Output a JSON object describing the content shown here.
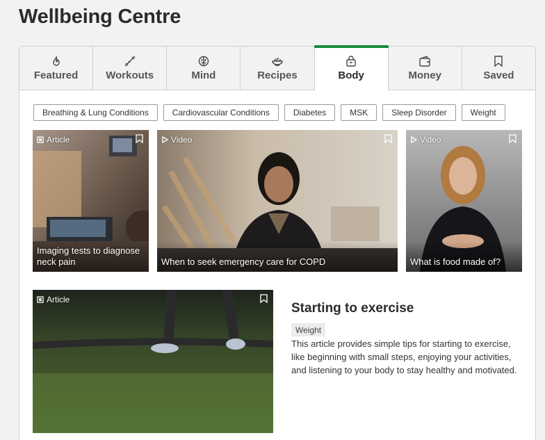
{
  "page": {
    "title": "Wellbeing Centre"
  },
  "tabs": [
    {
      "label": "Featured",
      "icon": "flame-icon"
    },
    {
      "label": "Workouts",
      "icon": "dumbbell-icon"
    },
    {
      "label": "Mind",
      "icon": "brain-icon"
    },
    {
      "label": "Recipes",
      "icon": "bowl-icon"
    },
    {
      "label": "Body",
      "icon": "scale-icon",
      "active": true
    },
    {
      "label": "Money",
      "icon": "wallet-icon"
    },
    {
      "label": "Saved",
      "icon": "bookmark-icon"
    }
  ],
  "chips": [
    "Breathing & Lung Conditions",
    "Cardiovascular Conditions",
    "Diabetes",
    "MSK",
    "Sleep Disorder",
    "Weight"
  ],
  "cards": [
    {
      "type": "Article",
      "title": "Imaging tests to diagnose neck pain"
    },
    {
      "type": "Video",
      "title": "When to seek emergency care for COPD"
    },
    {
      "type": "Video",
      "title": "What is food made of?"
    }
  ],
  "feature": {
    "type": "Article",
    "title": "Starting to exercise",
    "tag": "Weight",
    "description": "This article provides simple tips for starting to exercise, like beginning with small steps, enjoying your activities, and listening to your body to stay healthy and motivated."
  },
  "colors": {
    "accent": "#1a8a3c",
    "background": "#f2f2f2"
  }
}
